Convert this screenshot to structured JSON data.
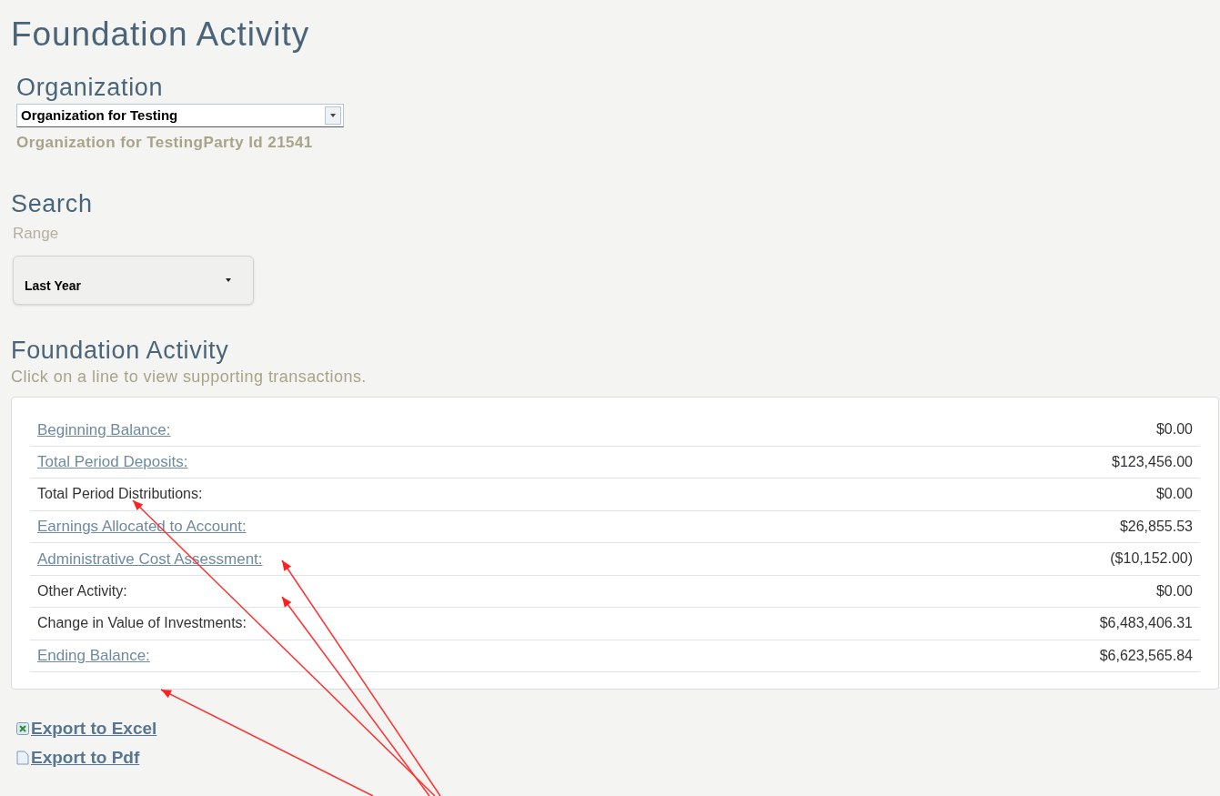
{
  "title": "Foundation Activity",
  "organization": {
    "heading": "Organization",
    "select_value": "Organization for Testing",
    "caption": "Organization for TestingParty Id 21541"
  },
  "search": {
    "heading": "Search",
    "range_label": "Range",
    "range_value": "Last Year"
  },
  "activity": {
    "heading": "Foundation Activity",
    "hint": "Click on a line to view supporting transactions.",
    "rows": [
      {
        "kind": "link",
        "label": "Beginning Balance:",
        "value": "$0.00"
      },
      {
        "kind": "link",
        "label": "Total Period Deposits:",
        "value": "$123,456.00"
      },
      {
        "kind": "plain",
        "label": "Total Period Distributions:",
        "value": "$0.00"
      },
      {
        "kind": "link",
        "label": "Earnings Allocated to Account:",
        "value": "$26,855.53"
      },
      {
        "kind": "link",
        "label": "Administrative Cost Assessment:",
        "value": "($10,152.00)"
      },
      {
        "kind": "plain",
        "label": "Other Activity:",
        "value": "$0.00"
      },
      {
        "kind": "plain",
        "label": "Change in Value of Investments:",
        "value": "$6,483,406.31"
      },
      {
        "kind": "link",
        "label": "Ending Balance:",
        "value": "$6,623,565.84"
      }
    ]
  },
  "exports": [
    {
      "kind": "excel",
      "label": "Export to Excel"
    },
    {
      "kind": "pdf",
      "label": "Export to Pdf"
    }
  ]
}
